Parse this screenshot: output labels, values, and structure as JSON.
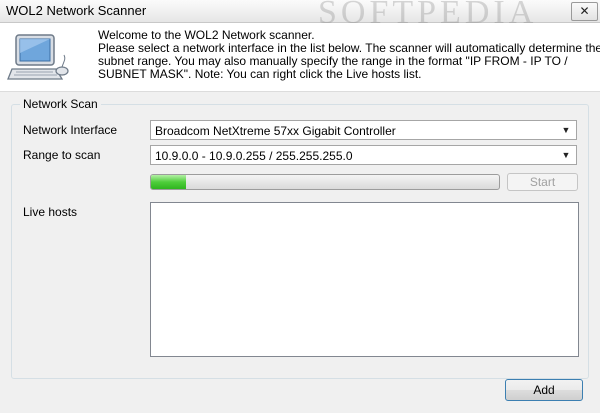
{
  "window": {
    "title": "WOL2 Network Scanner",
    "watermark": "SOFTPEDIA",
    "close_glyph": "✕"
  },
  "header": {
    "icon": "computer-monitor-icon",
    "intro_lines": [
      "Welcome to the WOL2 Network scanner.",
      "Please select a network interface in the list below. The scanner will automatically determine the",
      "subnet range. You may also manually specify the range in the format \"IP FROM - IP TO /",
      "SUBNET MASK\". Note: You can right click the Live hosts list."
    ]
  },
  "scan": {
    "group_title": "Network Scan",
    "interface_label": "Network Interface",
    "interface_value": "Broadcom NetXtreme 57xx Gigabit Controller",
    "range_label": "Range to scan",
    "range_value": "10.9.0.0 - 10.9.0.255 / 255.255.255.0",
    "progress_fraction": 0.1,
    "start_label": "Start",
    "live_hosts_label": "Live hosts",
    "live_hosts": []
  },
  "footer": {
    "add_label": "Add"
  },
  "colors": {
    "progress_green": "#4fce3b",
    "panel_bg": "#f0f0f0"
  }
}
